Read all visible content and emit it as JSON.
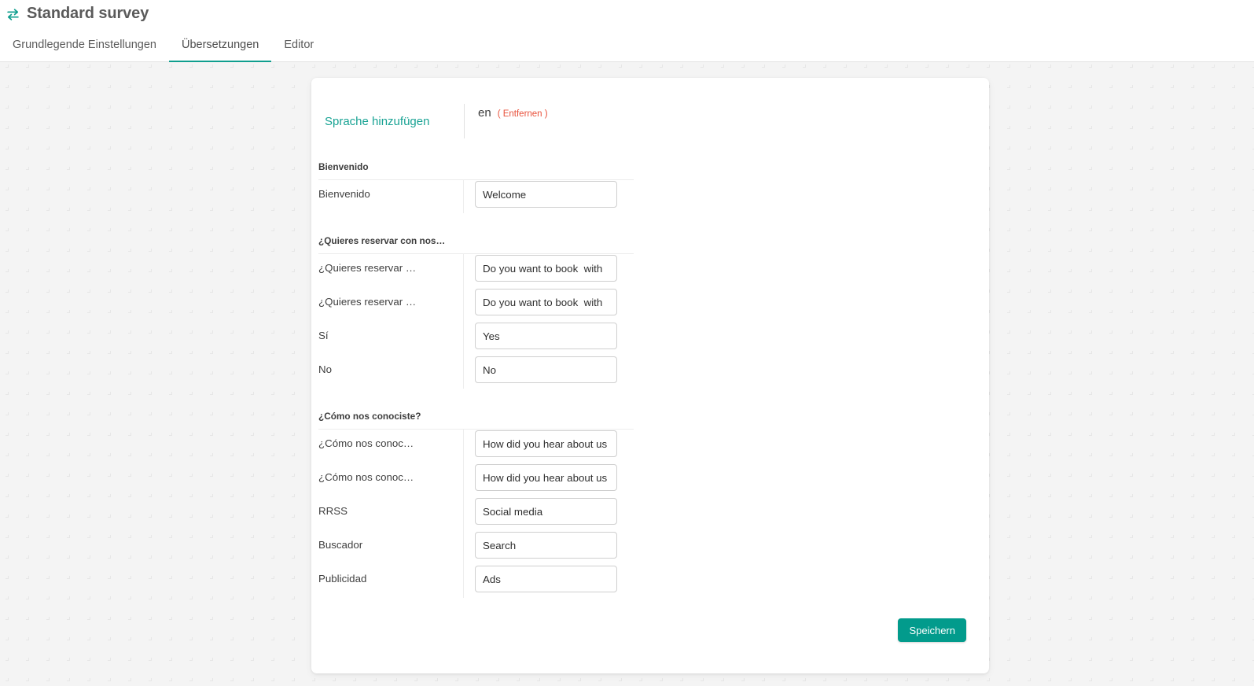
{
  "header": {
    "icon": "exchange-arrows-icon",
    "title": "Standard survey",
    "tabs": [
      {
        "label": "Grundlegende Einstellungen",
        "active": false
      },
      {
        "label": "Übersetzungen",
        "active": true
      },
      {
        "label": "Editor",
        "active": false
      }
    ]
  },
  "accent_color": "#0f9e8e",
  "save_color": "#029b8c",
  "remove_color": "#e8503a",
  "language_bar": {
    "add_language_label": "Sprache hinzufügen",
    "language_code": "en",
    "remove_label": "( Entfernen )"
  },
  "sections": [
    {
      "title": "Bienvenido",
      "rows": [
        {
          "label": "Bienvenido",
          "value": "Welcome"
        }
      ]
    },
    {
      "title": "¿Quieres reservar con nos…",
      "rows": [
        {
          "label": "¿Quieres reservar …",
          "value": "Do you want to book  with"
        },
        {
          "label": "¿Quieres reservar …",
          "value": "Do you want to book  with"
        },
        {
          "label": "Sí",
          "value": "Yes"
        },
        {
          "label": "No",
          "value": "No"
        }
      ]
    },
    {
      "title": "¿Cómo nos conociste?",
      "rows": [
        {
          "label": "¿Cómo nos conoc…",
          "value": "How did you hear about us"
        },
        {
          "label": "¿Cómo nos conoc…",
          "value": "How did you hear about us"
        },
        {
          "label": "RRSS",
          "value": "Social media"
        },
        {
          "label": "Buscador",
          "value": "Search"
        },
        {
          "label": "Publicidad",
          "value": "Ads"
        }
      ]
    }
  ],
  "footer": {
    "save_label": "Speichern"
  }
}
